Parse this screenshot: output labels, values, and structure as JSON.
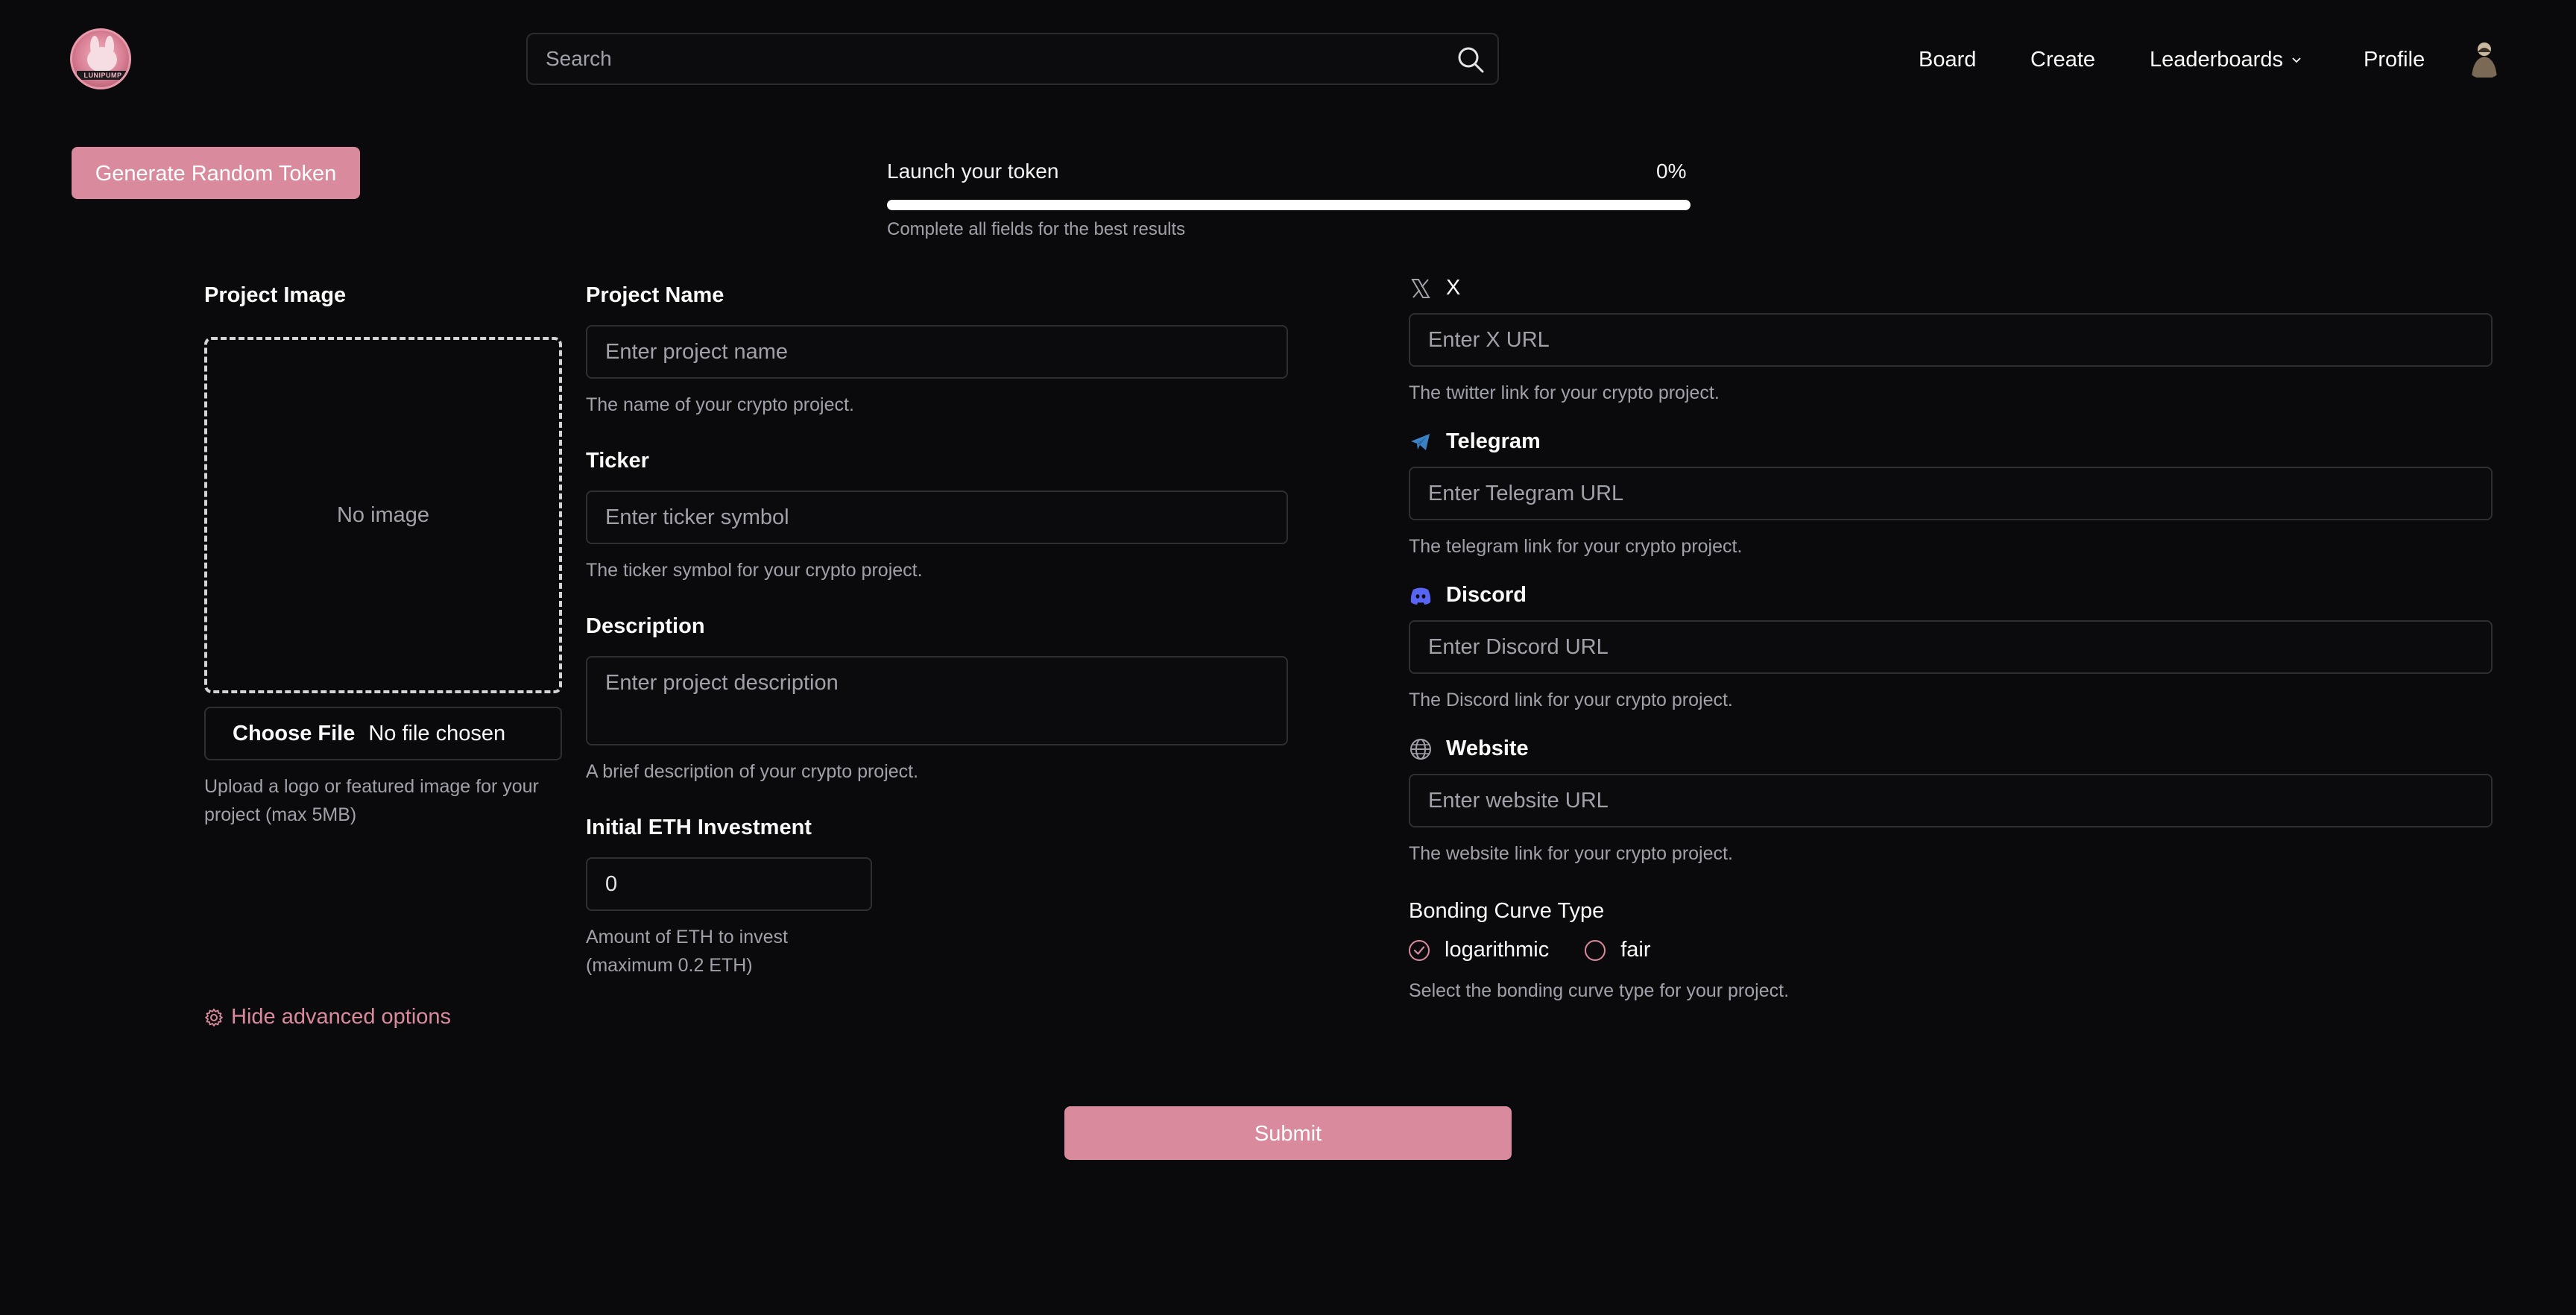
{
  "header": {
    "logo_text": "LUNIPUMP",
    "search_placeholder": "Search",
    "nav": {
      "board": "Board",
      "create": "Create",
      "leaderboards": "Leaderboards",
      "profile": "Profile"
    }
  },
  "toolbar": {
    "generate_label": "Generate Random Token"
  },
  "progress": {
    "title": "Launch your token",
    "percent_label": "0%",
    "percent_value": 0,
    "help": "Complete all fields for the best results"
  },
  "project_image": {
    "label": "Project Image",
    "empty_text": "No image",
    "choose_file_label": "Choose File",
    "file_status": "No file chosen",
    "help": "Upload a logo or featured image for your project (max 5MB)"
  },
  "project_name": {
    "label": "Project Name",
    "placeholder": "Enter project name",
    "help": "The name of your crypto project."
  },
  "ticker": {
    "label": "Ticker",
    "placeholder": "Enter ticker symbol",
    "help": "The ticker symbol for your crypto project."
  },
  "description": {
    "label": "Description",
    "placeholder": "Enter project description",
    "help": "A brief description of your crypto project."
  },
  "investment": {
    "label": "Initial ETH Investment",
    "value": "0",
    "help": "Amount of ETH to invest (maximum 0.2 ETH)"
  },
  "advanced": {
    "label": "Hide advanced options"
  },
  "socials": {
    "x": {
      "label": "X",
      "placeholder": "Enter X URL",
      "help": "The twitter link for your crypto project.",
      "icon": "x-icon"
    },
    "telegram": {
      "label": "Telegram",
      "placeholder": "Enter Telegram URL",
      "help": "The telegram link for your crypto project.",
      "icon": "telegram-icon",
      "color": "#3b82c4"
    },
    "discord": {
      "label": "Discord",
      "placeholder": "Enter Discord URL",
      "help": "The Discord link for your crypto project.",
      "icon": "discord-icon",
      "color": "#5865f2"
    },
    "website": {
      "label": "Website",
      "placeholder": "Enter website URL",
      "help": "The website link for your crypto project.",
      "icon": "globe-icon"
    }
  },
  "bonding": {
    "label": "Bonding Curve Type",
    "options": [
      "logarithmic",
      "fair"
    ],
    "selected": "logarithmic",
    "help": "Select the bonding curve type for your project."
  },
  "submit_label": "Submit",
  "colors": {
    "background": "#0a0a0c",
    "accent": "#d98a9c",
    "muted_text": "#a1a1aa",
    "border": "#2e2e33"
  }
}
